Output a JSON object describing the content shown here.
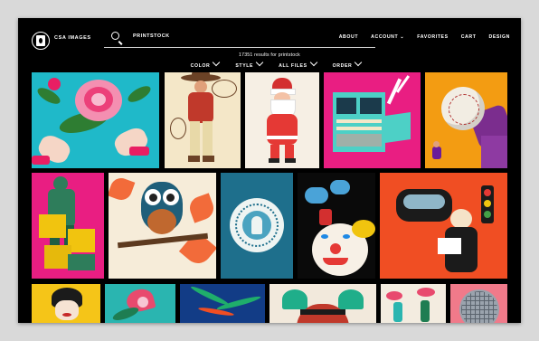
{
  "header": {
    "brand": "CSA IMAGES",
    "search_value": "PRINTSTOCK",
    "nav": [
      "ABOUT",
      "ACCOUNT ⌄",
      "FAVORITES",
      "CART",
      "DESIGN"
    ]
  },
  "results_text": "17351 results for printstock",
  "filters": [
    "COLOR",
    "STYLE",
    "ALL FILES",
    "ORDER"
  ],
  "tiles": [
    "rose-bouquet-illustration",
    "cowboy-with-lasso-illustration",
    "santa-claus-illustration",
    "vintage-computer-illustration",
    "hand-holding-baseball-illustration",
    "worker-carrying-boxes-illustration",
    "owl-on-branch-illustration",
    "ornamental-medallion-illustration",
    "circus-clown-and-elephants-illustration",
    "reader-with-traffic-light-illustration",
    "geisha-portrait-illustration",
    "pink-lily-flower-illustration",
    "palm-leaves-illustration",
    "hands-holding-bowl-illustration",
    "gardening-couple-illustration",
    "disco-ball-illustration"
  ],
  "colors": {
    "background": "#000000",
    "frame": "#d9d9d9",
    "text": "#ffffff"
  }
}
